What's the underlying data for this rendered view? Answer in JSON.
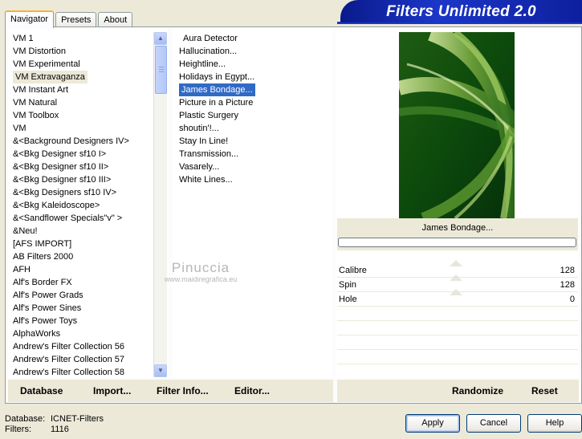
{
  "tabs": [
    {
      "label": "Navigator",
      "active": true
    },
    {
      "label": "Presets",
      "active": false
    },
    {
      "label": "About",
      "active": false
    }
  ],
  "app_title": "Filters Unlimited 2.0",
  "categories": [
    "VM 1",
    "VM Distortion",
    "VM Experimental",
    "VM Extravaganza",
    "VM Instant Art",
    "VM Natural",
    "VM Toolbox",
    "VM",
    "&<Background Designers IV>",
    "&<Bkg Designer sf10 I>",
    "&<Bkg Designer sf10 II>",
    "&<Bkg Designer sf10 III>",
    "&<Bkg Designers sf10 IV>",
    "&<Bkg Kaleidoscope>",
    "&<Sandflower Specials\"v\" >",
    "&Neu!",
    "[AFS IMPORT]",
    "AB Filters 2000",
    "AFH",
    "Alf's Border FX",
    "Alf's Power Grads",
    "Alf's Power Sines",
    "Alf's Power Toys",
    "AlphaWorks",
    "Andrew's Filter Collection 56",
    "Andrew's Filter Collection 57",
    "Andrew's Filter Collection 58"
  ],
  "selected_category_index": 3,
  "filters": [
    "Aura Detector",
    "Hallucination...",
    "Heightline...",
    "Holidays in Egypt...",
    "James Bondage...",
    "Picture in a Picture",
    "Plastic Surgery",
    "shoutin'!...",
    "Stay In Line!",
    "Transmission...",
    "Vasarely...",
    "White Lines..."
  ],
  "selected_filter_index": 4,
  "current_filter": "James Bondage...",
  "progress": 0,
  "params": [
    {
      "name": "Calibre",
      "value": "128"
    },
    {
      "name": "Spin",
      "value": "128"
    },
    {
      "name": "Hole",
      "value": "0"
    }
  ],
  "toolbar_left": {
    "database": "Database",
    "import": "Import...",
    "filter_info": "Filter Info...",
    "editor": "Editor..."
  },
  "toolbar_right": {
    "randomize": "Randomize",
    "reset": "Reset"
  },
  "status": {
    "database_label": "Database:",
    "database_value": "ICNET-Filters",
    "filters_label": "Filters:",
    "filters_value": "1116"
  },
  "buttons": {
    "apply": "Apply",
    "cancel": "Cancel",
    "help": "Help"
  },
  "watermark": {
    "line1": "Pinuccia",
    "line2": "www.maidiregrafica.eu"
  },
  "colors": {
    "title_bar": "#1c36c8",
    "selection_blue": "#316ac5",
    "preview_green": "#0a3c0a"
  }
}
